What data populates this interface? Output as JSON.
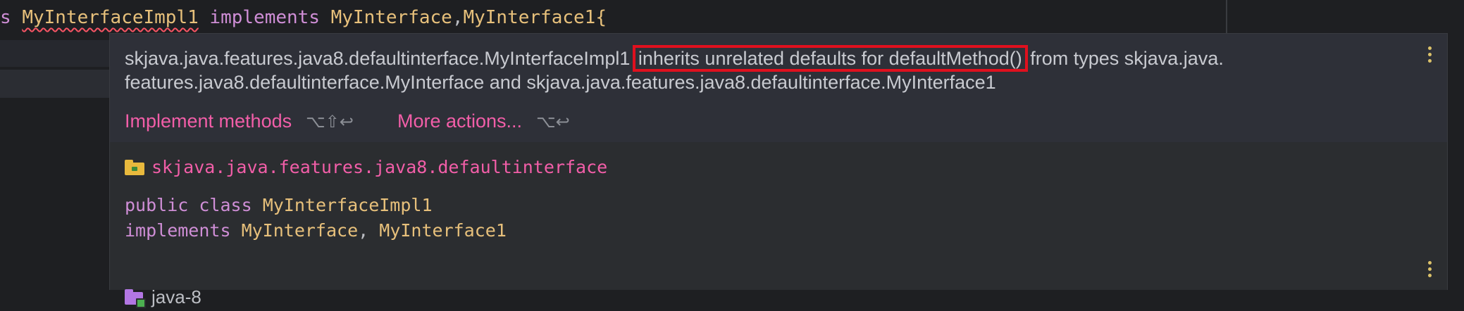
{
  "editor": {
    "code_line": {
      "prefix": "s",
      "class_name": "MyInterfaceImpl1",
      "keyword": "implements",
      "interface_1": "MyInterface",
      "comma": ",",
      "interface_2": "MyInterface1",
      "brace": "{"
    }
  },
  "popup": {
    "message": {
      "part_1": "skjava.java.features.java8.defaultinterface.MyInterfaceImpl1",
      "highlighted": "inherits unrelated defaults for defaultMethod()",
      "part_2": "from types skjava.java.",
      "line_2": "features.java8.defaultinterface.MyInterface and skjava.java.features.java8.defaultinterface.MyInterface1"
    },
    "actions": {
      "implement_label": "Implement methods",
      "implement_shortcut": "⌥⇧↩",
      "more_label": "More actions...",
      "more_shortcut": "⌥↩"
    },
    "declaration": {
      "package": "skjava.java.features.java8.defaultinterface",
      "line_1_kw": "public class",
      "line_1_class": "MyInterfaceImpl1",
      "line_2_kw": "implements",
      "line_2_iface_1": "MyInterface",
      "line_2_comma": ", ",
      "line_2_iface_2": "MyInterface1",
      "module": "java-8"
    },
    "icons": {
      "package": "folder-icon",
      "module": "module-folder-icon",
      "more": "kebab-menu-icon"
    },
    "colors": {
      "link": "#f25ea8",
      "keyword": "#cf8ed6",
      "class": "#e7c07b",
      "error_underline": "#f75464",
      "highlight_box": "#e0101e"
    }
  }
}
